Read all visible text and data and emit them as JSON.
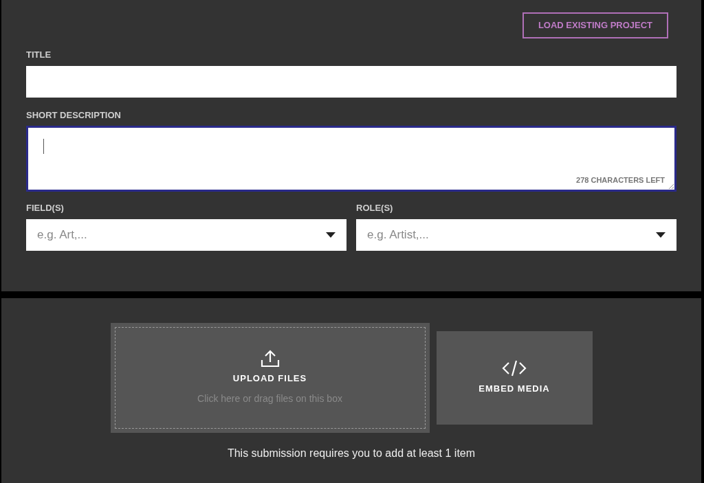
{
  "load_button": "LOAD EXISTING PROJECT",
  "title_field": {
    "label": "TITLE"
  },
  "description_field": {
    "label": "SHORT DESCRIPTION",
    "focused": true,
    "counter": "278 CHARACTERS LEFT"
  },
  "dropdowns": [
    {
      "label": "FIELD(S)",
      "placeholder": "e.g. Art,..."
    },
    {
      "label": "ROLE(S)",
      "placeholder": "e.g. Artist,..."
    }
  ],
  "upload": {
    "title": "UPLOAD FILES",
    "hint": "Click here or drag files on this box"
  },
  "embed": {
    "title": "EMBED MEDIA"
  },
  "requirement_note": "This submission requires you to add at least 1 item"
}
